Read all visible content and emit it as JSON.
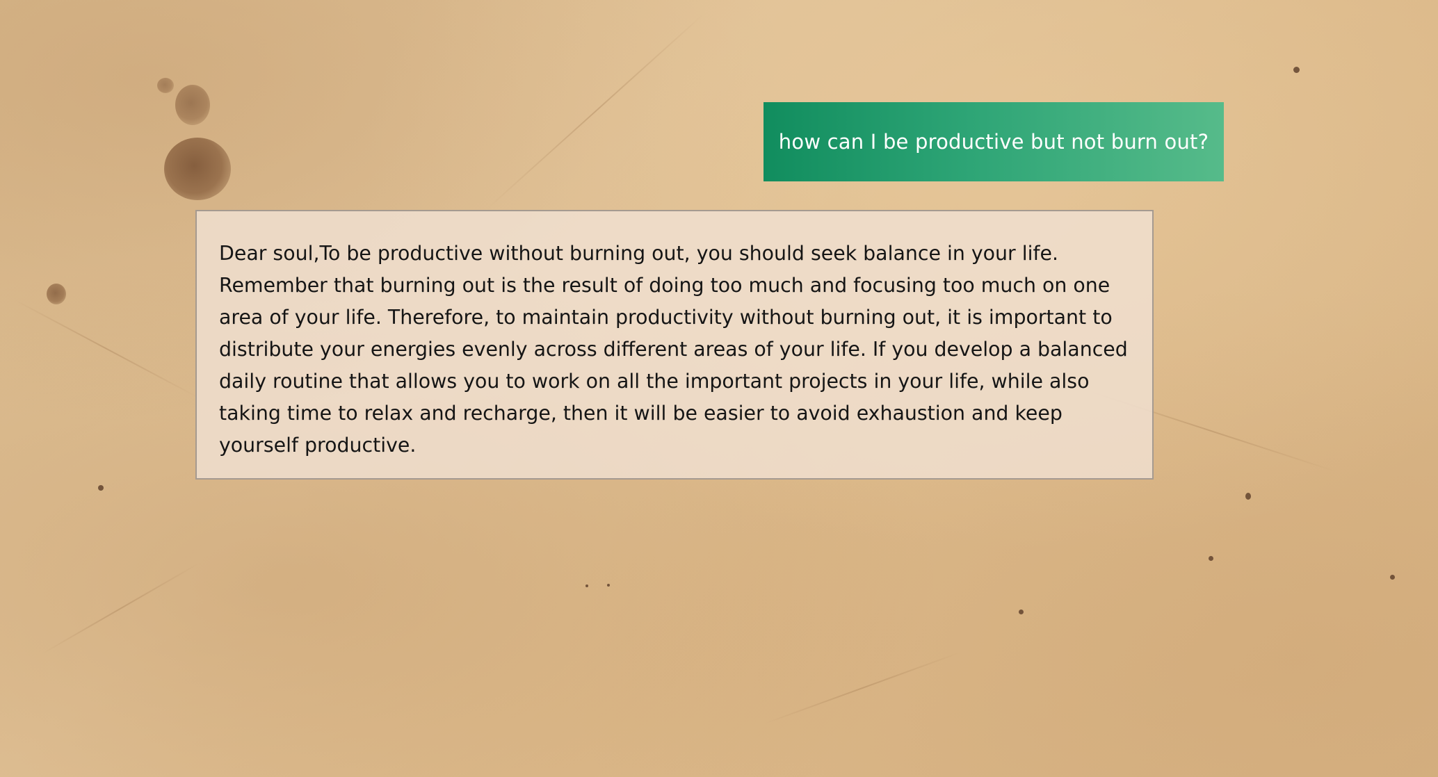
{
  "conversation": {
    "user_message": "how can I be productive but not burn out?",
    "reply_message": "Dear soul,To be productive without burning out, you should seek balance in your life. Remember that burning out is the result of doing too much and focusing too much on one area of your life. Therefore, to maintain productivity without burning out, it is important to distribute your energies evenly across different areas of your life. If you develop a balanced daily routine that allows you to work on all the important projects in your life, while also taking time to relax and recharge, then it will be easier to avoid exhaustion and keep yourself productive."
  },
  "colors": {
    "background": "#d9b98c",
    "user_bubble_start": "#118d5e",
    "user_bubble_end": "#56bb8a",
    "user_text": "#ffffff",
    "reply_background": "#efe0d2",
    "reply_border": "#a59a90",
    "reply_text": "#151515"
  }
}
